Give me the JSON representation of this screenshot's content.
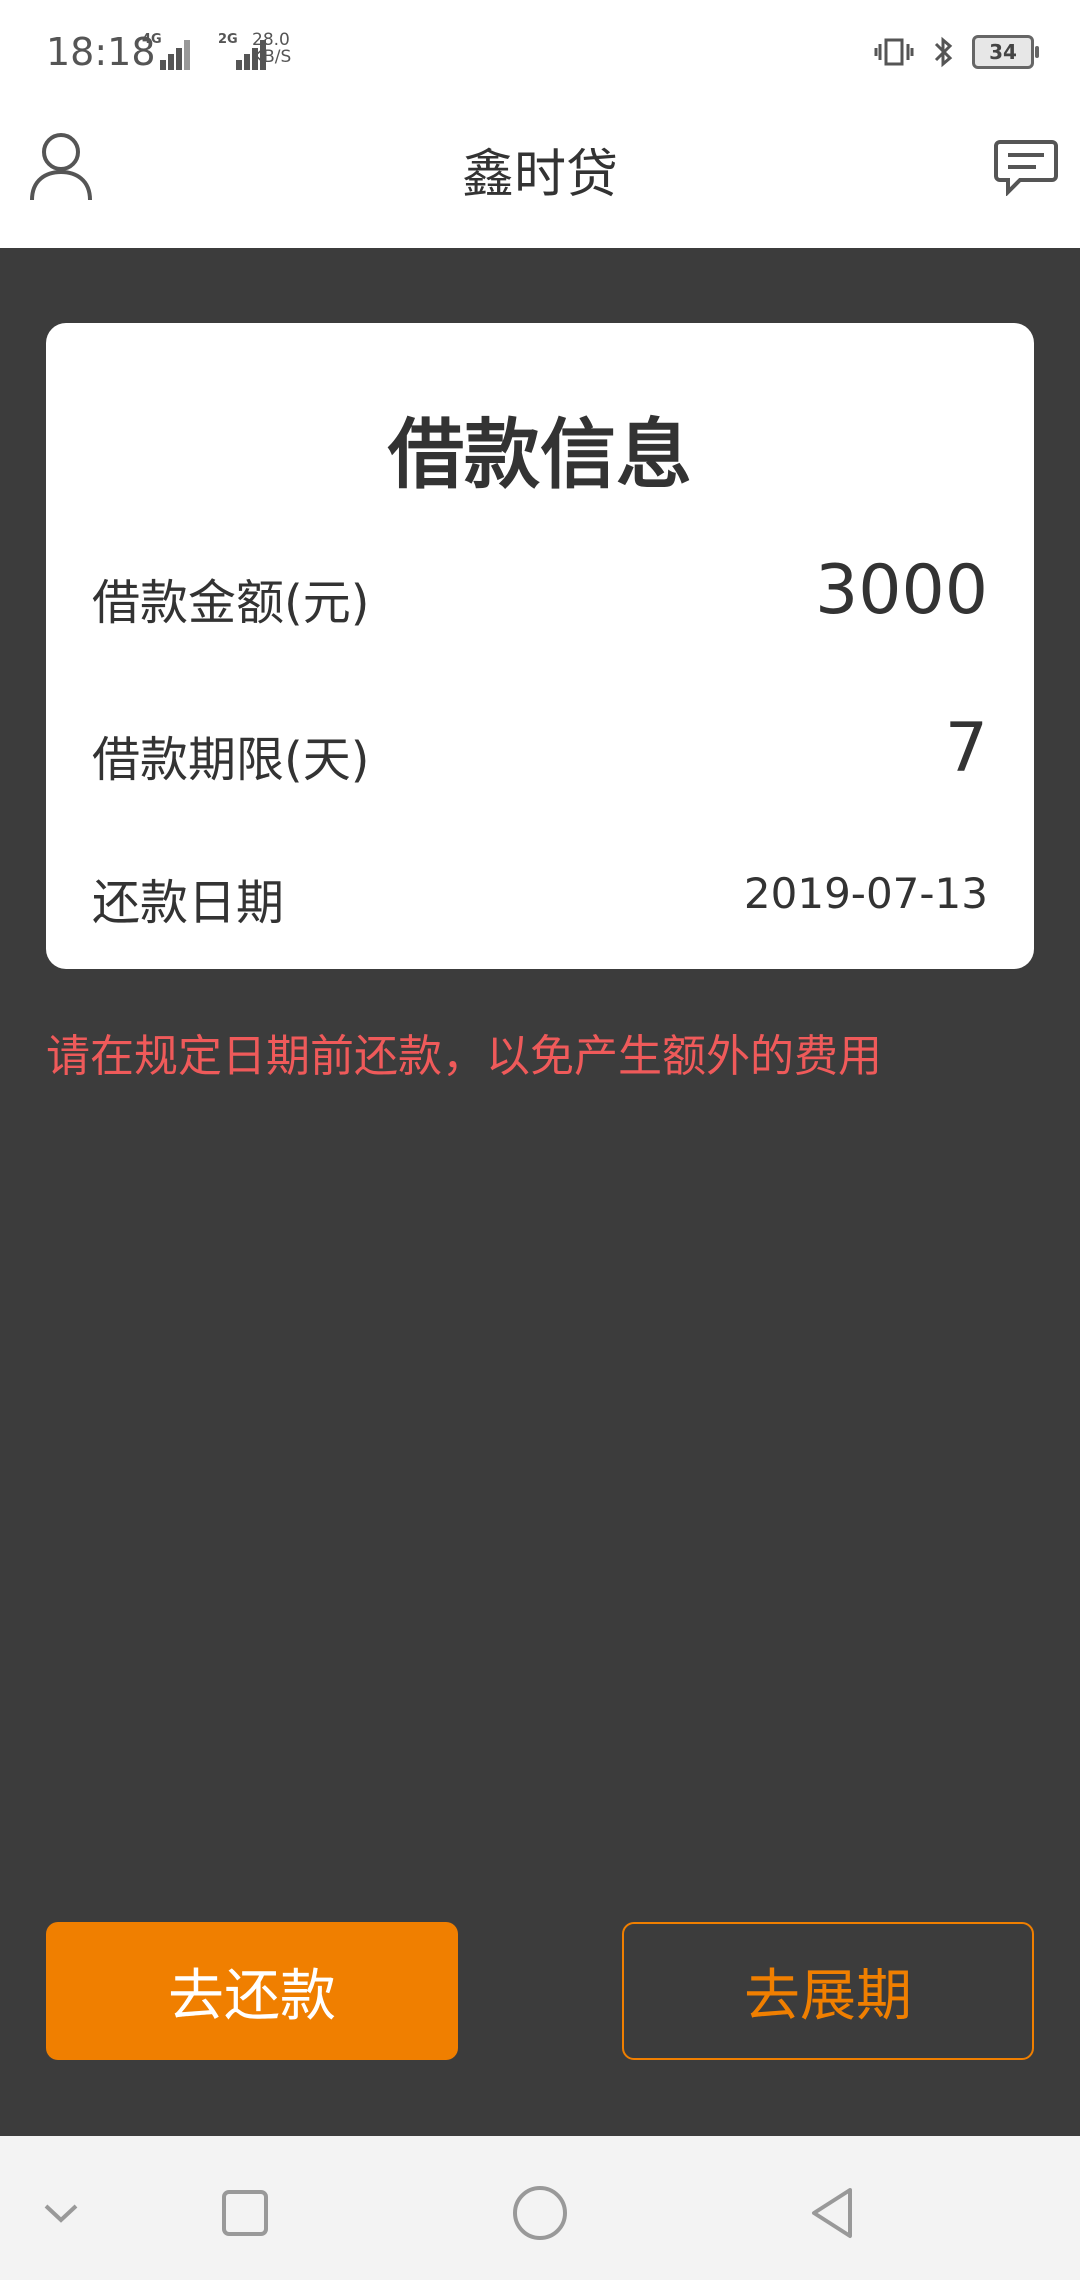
{
  "status_bar": {
    "time": "18:18",
    "signal1": "4G",
    "signal2": "2G",
    "net_speed_value": "28.0",
    "net_speed_unit": "KB/S",
    "battery": "34"
  },
  "header": {
    "title": "鑫时贷"
  },
  "card": {
    "title": "借款信息",
    "rows": [
      {
        "label": "借款金额(元)",
        "value": "3000"
      },
      {
        "label": "借款期限(天)",
        "value": "7"
      },
      {
        "label": "还款日期",
        "value": "2019-07-13"
      }
    ]
  },
  "notice": "请在规定日期前还款，以免产生额外的费用",
  "actions": {
    "repay_label": "去还款",
    "extend_label": "去展期"
  },
  "colors": {
    "accent": "#f07f00",
    "warning": "#ef5a5a",
    "background": "#3c3c3c"
  }
}
